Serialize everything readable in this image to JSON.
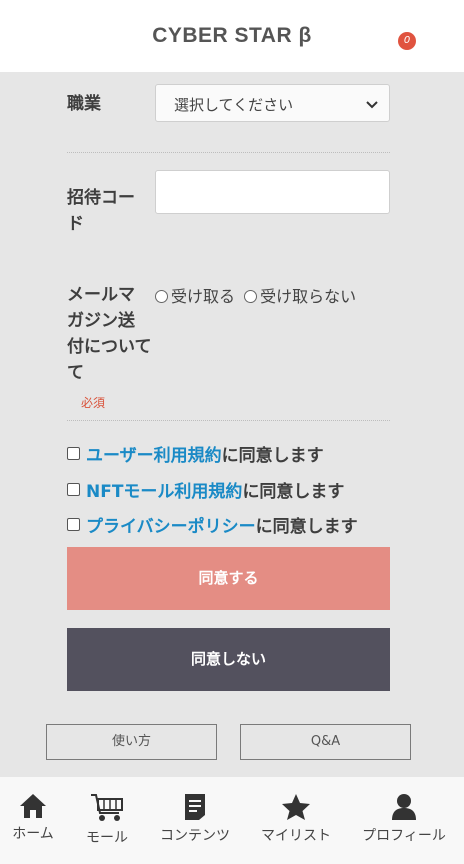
{
  "header": {
    "title": "CYBER STAR β",
    "cart_count": "0"
  },
  "form": {
    "occupation": {
      "label": "職業",
      "selected": "選択してください"
    },
    "invite_code": {
      "label_line1": "招待コー",
      "label_line2": "ド",
      "value": ""
    },
    "newsletter": {
      "label_lines": [
        "メールマ",
        "ガジン送",
        "付について",
        "て"
      ],
      "required": "必須",
      "options": [
        "受け取る",
        "受け取らない"
      ]
    },
    "agreements": [
      {
        "link": "ユーザー利用規約",
        "suffix": "に同意します"
      },
      {
        "link": "NFTモール利用規約",
        "suffix": "に同意します"
      },
      {
        "link": "プライバシーポリシー",
        "suffix": "に同意します"
      }
    ],
    "agree_button": "同意する",
    "disagree_button": "同意しない"
  },
  "footer_links": {
    "how_to": "使い方",
    "qa": "Q&A"
  },
  "bottom_nav": [
    {
      "label": "ホーム",
      "icon": "home-icon"
    },
    {
      "label": "モール",
      "icon": "cart-icon"
    },
    {
      "label": "コンテンツ",
      "icon": "document-icon"
    },
    {
      "label": "マイリスト",
      "icon": "star-icon"
    },
    {
      "label": "プロフィール",
      "icon": "user-icon"
    }
  ],
  "colors": {
    "link": "#1a8ac6",
    "agree_button": "#e48d84",
    "disagree_button": "#53515e",
    "badge": "#e0533f",
    "required": "#d9533b"
  }
}
